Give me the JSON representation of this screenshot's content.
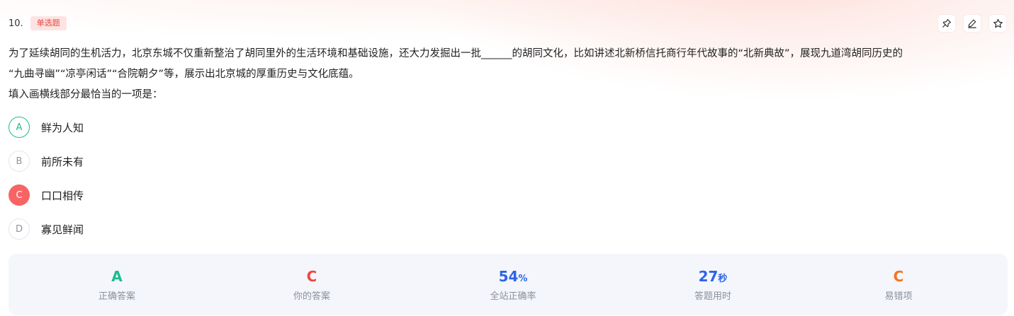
{
  "question": {
    "number": "10.",
    "type_badge": "单选题",
    "stem_line1": "为了延续胡同的生机活力，北京东城不仅重新整治了胡同里外的生活环境和基础设施，还大力发掘出一批______的胡同文化，比如讲述北新桥信托商行年代故事的“北新典故”，展现九道湾胡同历史的",
    "stem_line2": "“九曲寻幽”“凉亭闲话”“合院朝夕”等，展示出北京城的厚重历史与文化底蕴。",
    "prompt": "填入画横线部分最恰当的一项是："
  },
  "toolbar": {
    "pin_icon": "pin-icon",
    "edit_icon": "edit-icon",
    "star_icon": "star-icon"
  },
  "options": [
    {
      "letter": "A",
      "text": "鲜为人知",
      "state": "correct"
    },
    {
      "letter": "B",
      "text": "前所未有",
      "state": "normal"
    },
    {
      "letter": "C",
      "text": "口口相传",
      "state": "selected-wrong"
    },
    {
      "letter": "D",
      "text": "寡见鲜闻",
      "state": "normal"
    }
  ],
  "stats": {
    "correct_answer": {
      "value": "A",
      "label": "正确答案"
    },
    "your_answer": {
      "value": "C",
      "label": "你的答案"
    },
    "accuracy": {
      "value": "54",
      "unit": "%",
      "label": "全站正确率"
    },
    "time": {
      "value": "27",
      "unit": "秒",
      "label": "答题用时"
    },
    "common_wrong": {
      "value": "C",
      "label": "易错项"
    }
  },
  "colors": {
    "correct": "#1dbb8f",
    "wrong": "#f76464",
    "accent_blue": "#2e64e8",
    "accent_orange": "#f4741f",
    "badge_text": "#e8473f",
    "badge_bg": "#fde3e1",
    "stats_bg": "#f4f6fb"
  }
}
